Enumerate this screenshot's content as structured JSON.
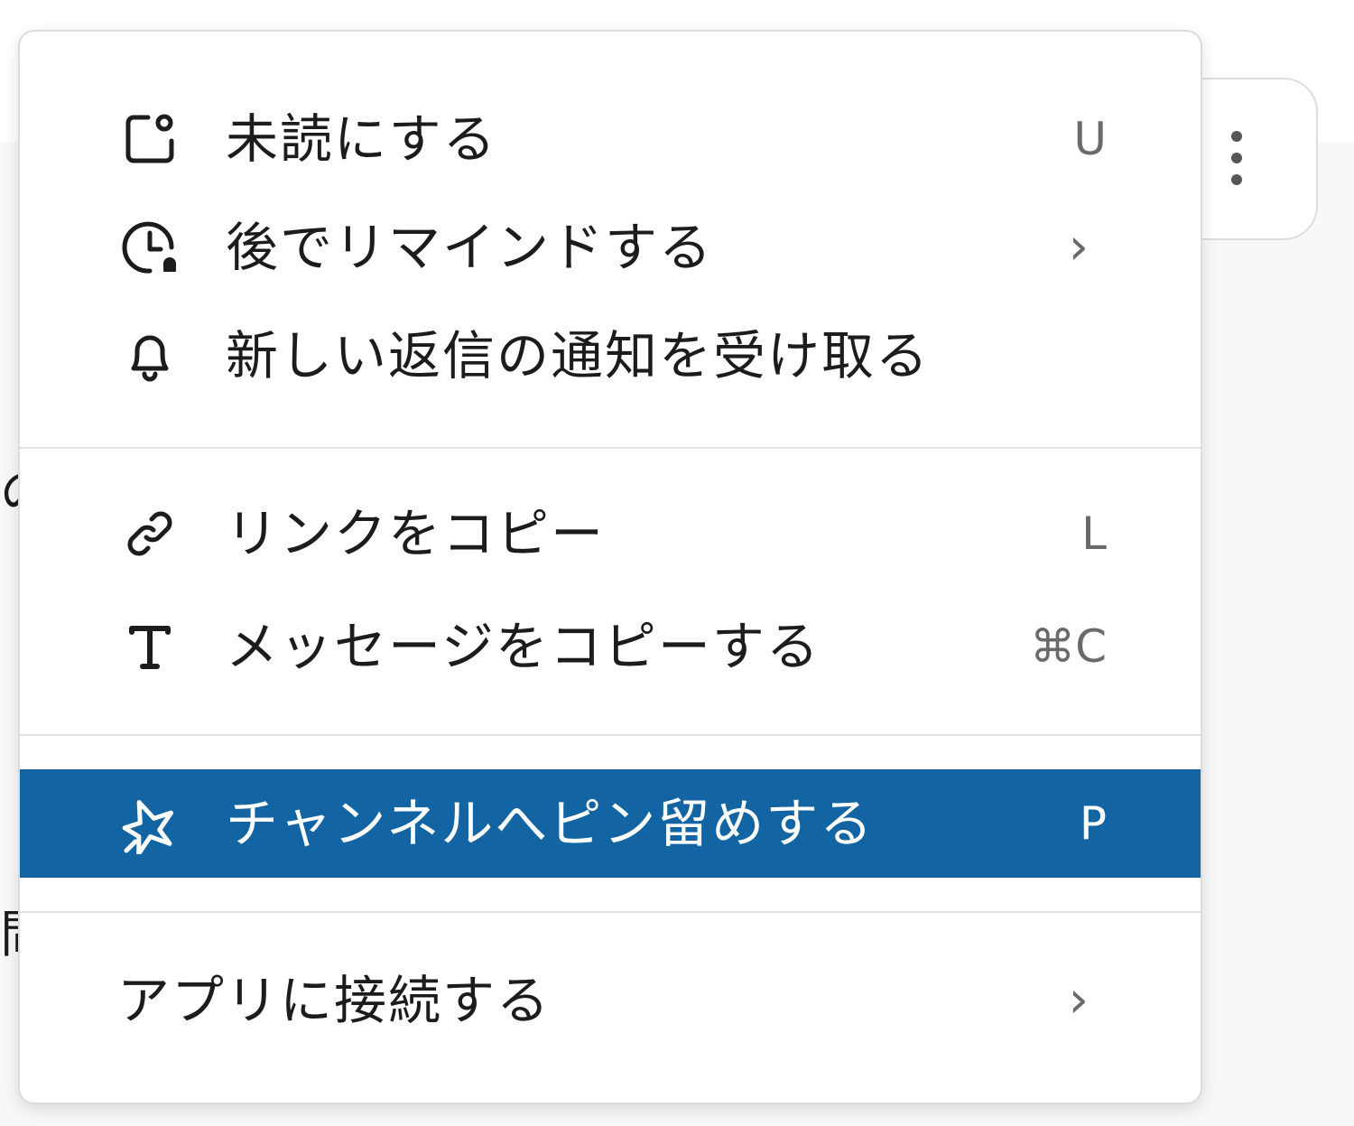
{
  "background": {
    "fragment_1": "の",
    "fragment_2": "問"
  },
  "toolbar": {
    "more_icon": "vertical-ellipsis-icon"
  },
  "menu": {
    "group1": [
      {
        "label": "未読にする",
        "shortcut": "U",
        "icon": "mark-unread-icon"
      },
      {
        "label": "後でリマインドする",
        "shortcut": "›",
        "icon": "clock-bell-icon"
      },
      {
        "label": "新しい返信の通知を受け取る",
        "shortcut": "",
        "icon": "bell-icon"
      }
    ],
    "group2": [
      {
        "label": "リンクをコピー",
        "shortcut": "L",
        "icon": "link-icon"
      },
      {
        "label": "メッセージをコピーする",
        "shortcut": "⌘C",
        "icon": "text-t-icon"
      }
    ],
    "group3": [
      {
        "label": "チャンネルへピン留めする",
        "shortcut": "P",
        "icon": "pin-icon",
        "selected": true
      }
    ],
    "group4": [
      {
        "label": "アプリに接続する",
        "shortcut": "›"
      }
    ]
  },
  "colors": {
    "selected_bg": "#1264a3",
    "text": "#1d1c1d",
    "shortcut": "#6b6a6b"
  }
}
